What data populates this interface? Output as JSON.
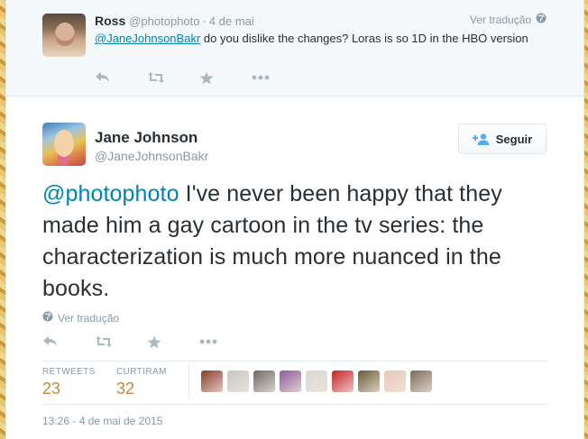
{
  "reply": {
    "name": "Ross",
    "handle": "@photophoto",
    "separator": "·",
    "date": "4 de mai",
    "translate": "Ver tradução",
    "mention": "@JaneJohnsonBakr",
    "text": " do you dislike the changes? Loras is so 1D in the HBO version",
    "actions": [
      "reply-icon",
      "retweet-icon",
      "favorite-icon",
      "more-icon"
    ]
  },
  "main": {
    "name": "Jane Johnson",
    "handle": "@JaneJohnsonBakr",
    "follow_label": "Seguir",
    "mention": "@photophoto",
    "text": " I've never been happy that they made him a gay cartoon in the tv series: the characterization is much more nuanced in the books.",
    "translate": "Ver tradução",
    "actions": [
      "reply-icon",
      "retweet-icon",
      "favorite-icon",
      "more-icon"
    ],
    "retweets_label": "RETWEETS",
    "retweets": "23",
    "favorites_label": "CURTIRAM",
    "favorites": "32",
    "favoriter_avatars": [
      "#8a3a2a",
      "#c7c7c7",
      "#6b6b6b",
      "#8e5a9a",
      "#d8d8d8",
      "#c8202a",
      "#6a5a3a",
      "#e8c8b8",
      "#7a6a5a"
    ],
    "timestamp": "13:26 - 4 de mai de 2015"
  },
  "colors": {
    "link": "#0084b4",
    "stat_value": "#c18a3a",
    "muted": "#8899a6",
    "text": "#292f33"
  }
}
